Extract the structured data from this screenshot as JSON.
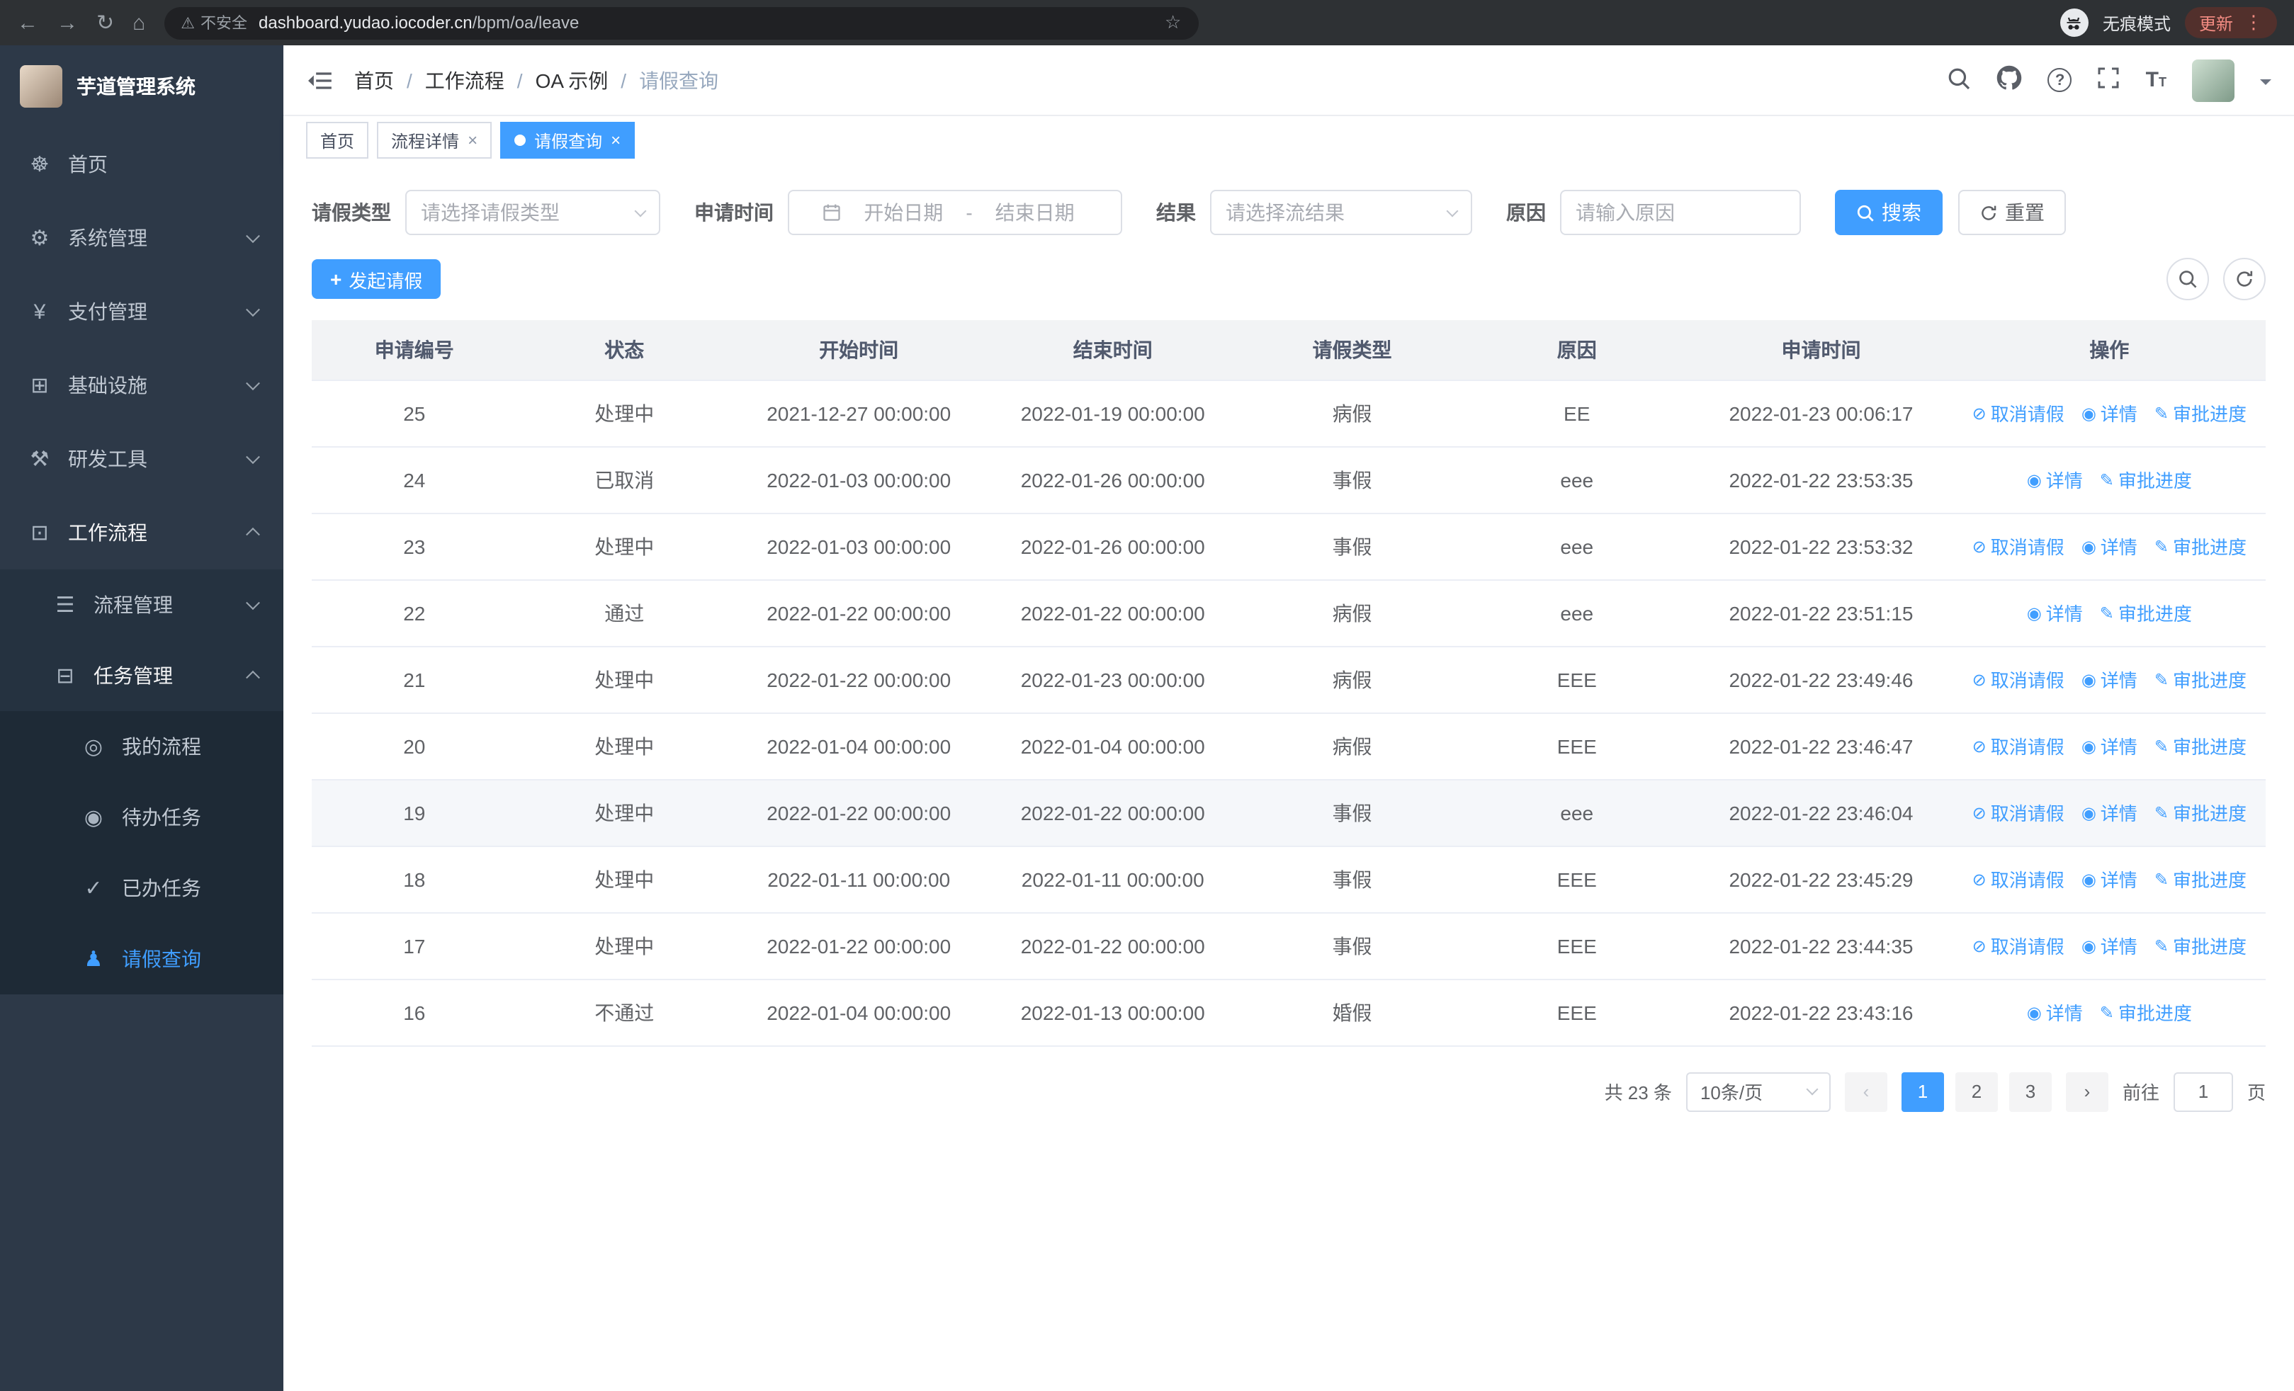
{
  "browser": {
    "security_label": "不安全",
    "url_host": "dashboard.yudao.iocoder.cn",
    "url_path": "/bpm/oa/leave",
    "incognito_label": "无痕模式",
    "update_label": "更新"
  },
  "sidebar": {
    "logo_title": "芋道管理系统",
    "items": [
      {
        "key": "home",
        "label": "首页",
        "icon": "dashboard-icon",
        "depth": 0
      },
      {
        "key": "system-management",
        "label": "系统管理",
        "icon": "gear-icon",
        "depth": 0,
        "arrow": "down"
      },
      {
        "key": "payment-management",
        "label": "支付管理",
        "icon": "yen-icon",
        "depth": 0,
        "arrow": "down"
      },
      {
        "key": "infrastructure",
        "label": "基础设施",
        "icon": "infrastructure-icon",
        "depth": 0,
        "arrow": "down"
      },
      {
        "key": "dev-tools",
        "label": "研发工具",
        "icon": "devtools-icon",
        "depth": 0,
        "arrow": "down"
      },
      {
        "key": "workflow",
        "label": "工作流程",
        "icon": "workflow-icon",
        "depth": 0,
        "arrow": "up",
        "open": true
      },
      {
        "key": "process-management",
        "label": "流程管理",
        "icon": "process-icon",
        "depth": 1,
        "arrow": "down"
      },
      {
        "key": "task-management",
        "label": "任务管理",
        "icon": "task-icon",
        "depth": 1,
        "arrow": "up",
        "open": true
      },
      {
        "key": "my-process",
        "label": "我的流程",
        "icon": "chat-icon",
        "depth": 2
      },
      {
        "key": "todo-tasks",
        "label": "待办任务",
        "icon": "eye-icon",
        "depth": 2
      },
      {
        "key": "done-tasks",
        "label": "已办任务",
        "icon": "check-icon",
        "depth": 2
      },
      {
        "key": "leave-query",
        "label": "请假查询",
        "icon": "user-icon",
        "depth": 2,
        "active": true
      }
    ]
  },
  "header": {
    "breadcrumb": [
      "首页",
      "工作流程",
      "OA 示例",
      "请假查询"
    ]
  },
  "tags": [
    {
      "label": "首页",
      "active": false,
      "closable": false
    },
    {
      "label": "流程详情",
      "active": false,
      "closable": true
    },
    {
      "label": "请假查询",
      "active": true,
      "closable": true
    }
  ],
  "filters": {
    "leave_type": {
      "label": "请假类型",
      "placeholder": "请选择请假类型"
    },
    "apply_time": {
      "label": "申请时间",
      "start_placeholder": "开始日期",
      "separator": "-",
      "end_placeholder": "结束日期"
    },
    "result": {
      "label": "结果",
      "placeholder": "请选择流结果"
    },
    "reason": {
      "label": "原因",
      "placeholder": "请输入原因"
    },
    "search_label": "搜索",
    "reset_label": "重置"
  },
  "toolbar": {
    "create_label": "发起请假"
  },
  "table": {
    "columns": [
      "申请编号",
      "状态",
      "开始时间",
      "结束时间",
      "请假类型",
      "原因",
      "申请时间",
      "操作"
    ],
    "action_labels": {
      "cancel": "取消请假",
      "detail": "详情",
      "progress": "审批进度"
    },
    "rows": [
      {
        "id": "25",
        "status": "处理中",
        "start": "2021-12-27 00:00:00",
        "end": "2022-01-19 00:00:00",
        "type": "病假",
        "reason": "EE",
        "apply_time": "2022-01-23 00:06:17",
        "actions": [
          "cancel",
          "detail",
          "progress"
        ],
        "highlight": false
      },
      {
        "id": "24",
        "status": "已取消",
        "start": "2022-01-03 00:00:00",
        "end": "2022-01-26 00:00:00",
        "type": "事假",
        "reason": "eee",
        "apply_time": "2022-01-22 23:53:35",
        "actions": [
          "detail",
          "progress"
        ],
        "highlight": false
      },
      {
        "id": "23",
        "status": "处理中",
        "start": "2022-01-03 00:00:00",
        "end": "2022-01-26 00:00:00",
        "type": "事假",
        "reason": "eee",
        "apply_time": "2022-01-22 23:53:32",
        "actions": [
          "cancel",
          "detail",
          "progress"
        ],
        "highlight": false
      },
      {
        "id": "22",
        "status": "通过",
        "start": "2022-01-22 00:00:00",
        "end": "2022-01-22 00:00:00",
        "type": "病假",
        "reason": "eee",
        "apply_time": "2022-01-22 23:51:15",
        "actions": [
          "detail",
          "progress"
        ],
        "highlight": false
      },
      {
        "id": "21",
        "status": "处理中",
        "start": "2022-01-22 00:00:00",
        "end": "2022-01-23 00:00:00",
        "type": "病假",
        "reason": "EEE",
        "apply_time": "2022-01-22 23:49:46",
        "actions": [
          "cancel",
          "detail",
          "progress"
        ],
        "highlight": false
      },
      {
        "id": "20",
        "status": "处理中",
        "start": "2022-01-04 00:00:00",
        "end": "2022-01-04 00:00:00",
        "type": "病假",
        "reason": "EEE",
        "apply_time": "2022-01-22 23:46:47",
        "actions": [
          "cancel",
          "detail",
          "progress"
        ],
        "highlight": false
      },
      {
        "id": "19",
        "status": "处理中",
        "start": "2022-01-22 00:00:00",
        "end": "2022-01-22 00:00:00",
        "type": "事假",
        "reason": "eee",
        "apply_time": "2022-01-22 23:46:04",
        "actions": [
          "cancel",
          "detail",
          "progress"
        ],
        "highlight": true
      },
      {
        "id": "18",
        "status": "处理中",
        "start": "2022-01-11 00:00:00",
        "end": "2022-01-11 00:00:00",
        "type": "事假",
        "reason": "EEE",
        "apply_time": "2022-01-22 23:45:29",
        "actions": [
          "cancel",
          "detail",
          "progress"
        ],
        "highlight": false
      },
      {
        "id": "17",
        "status": "处理中",
        "start": "2022-01-22 00:00:00",
        "end": "2022-01-22 00:00:00",
        "type": "事假",
        "reason": "EEE",
        "apply_time": "2022-01-22 23:44:35",
        "actions": [
          "cancel",
          "detail",
          "progress"
        ],
        "highlight": false
      },
      {
        "id": "16",
        "status": "不通过",
        "start": "2022-01-04 00:00:00",
        "end": "2022-01-13 00:00:00",
        "type": "婚假",
        "reason": "EEE",
        "apply_time": "2022-01-22 23:43:16",
        "actions": [
          "detail",
          "progress"
        ],
        "highlight": false
      }
    ]
  },
  "pagination": {
    "total_label": "共 23 条",
    "page_size_label": "10条/页",
    "pages": [
      "1",
      "2",
      "3"
    ],
    "active_page": "1",
    "goto_label": "前往",
    "goto_value": "1",
    "goto_suffix": "页"
  }
}
